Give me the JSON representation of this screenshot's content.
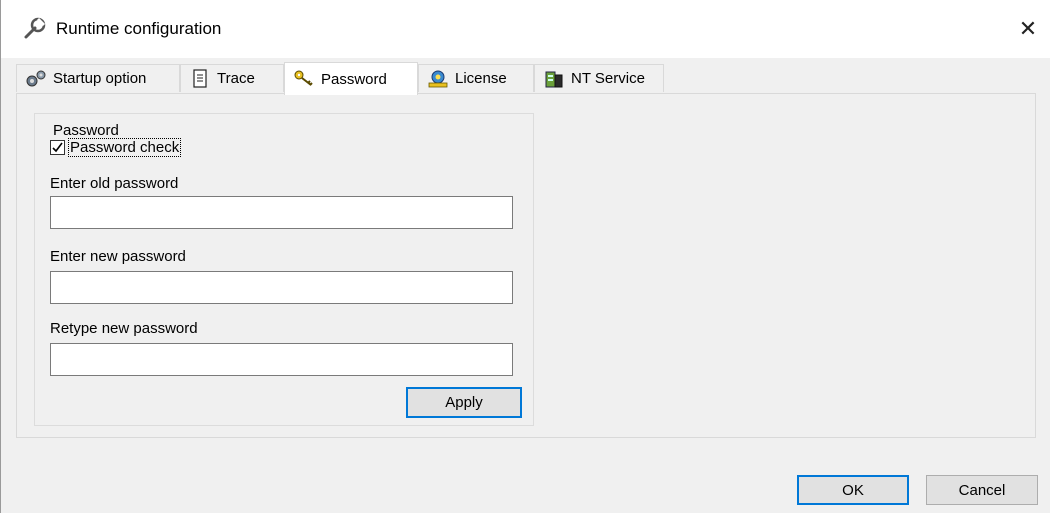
{
  "window": {
    "title": "Runtime configuration",
    "close_glyph": "✕",
    "icon": "wrench-icon"
  },
  "tabs": [
    {
      "label": "Startup option",
      "icon": "gears-icon",
      "active": false
    },
    {
      "label": "Trace",
      "icon": "document-icon",
      "active": false
    },
    {
      "label": "Password",
      "icon": "keys-icon",
      "active": true
    },
    {
      "label": "License",
      "icon": "license-icon",
      "active": false
    },
    {
      "label": "NT Service",
      "icon": "server-icon",
      "active": false
    }
  ],
  "password_group": {
    "title": "Password",
    "check_label": "Password check",
    "checked": true,
    "old_label": "Enter old password",
    "old_value": "",
    "new_label": "Enter new password",
    "new_value": "",
    "retype_label": "Retype new password",
    "retype_value": "",
    "apply_label": "Apply"
  },
  "footer": {
    "ok_label": "OK",
    "cancel_label": "Cancel"
  },
  "colors": {
    "accent": "#0078d7",
    "background": "#f0f0f0"
  }
}
